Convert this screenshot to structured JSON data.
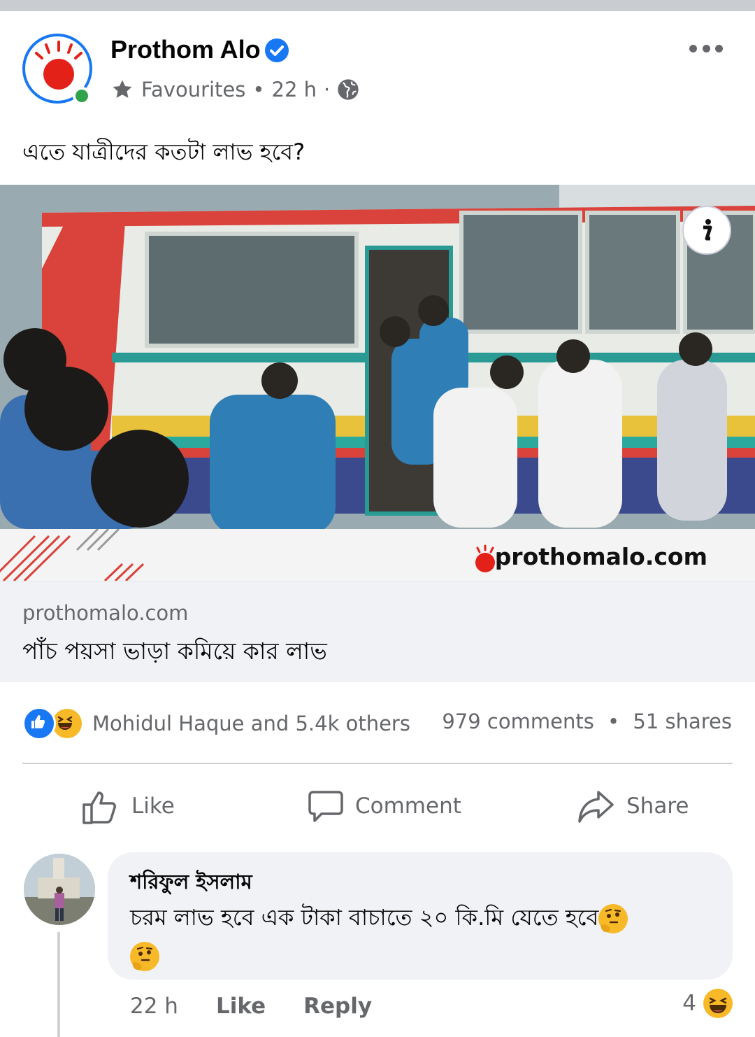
{
  "post": {
    "page_name": "Prothom Alo",
    "verified_icon": "verified-badge-icon",
    "meta_label": "Favourites",
    "separator": "•",
    "time": "22 h",
    "separator2": "·",
    "text": "এতে যাত্রীদের কতটা লাভ হবে?"
  },
  "image": {
    "brand": "prothomalo.com"
  },
  "link": {
    "domain": "prothomalo.com",
    "title": "পাঁচ পয়সা ভাড়া কমিয়ে কার লাভ"
  },
  "stats": {
    "reactors": "Mohidul Haque and 5.4k others",
    "comments": "979 comments",
    "dot": "•",
    "shares": "51 shares"
  },
  "actions": {
    "like": "Like",
    "comment": "Comment",
    "share": "Share"
  },
  "comment": {
    "author": "শরিফুল ইসলাম",
    "text": "চরম লাভ হবে এক টাকা বাচাতে ২০ কি.মি যেতে হবে",
    "time": "22 h",
    "like": "Like",
    "reply": "Reply",
    "reaction_count": "4"
  },
  "colors": {
    "brand_blue": "#1877f2",
    "brand_red": "#e32119",
    "muted": "#65676b",
    "online": "#31a24c"
  }
}
